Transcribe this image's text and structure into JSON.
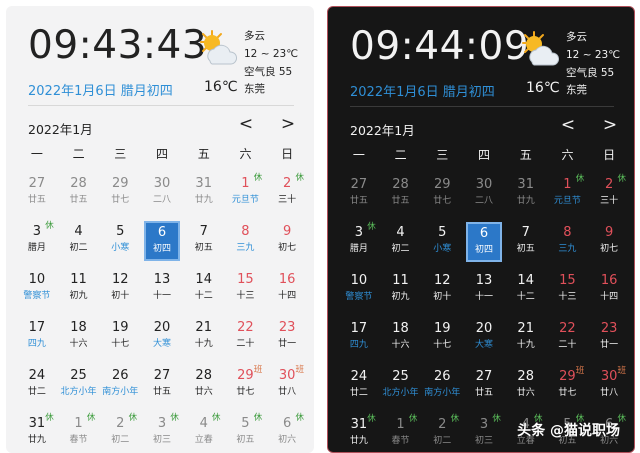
{
  "light": {
    "time": "09:43:43",
    "date": "2022年1月6日 腊月初四",
    "weather": {
      "condition": "多云",
      "range": "12 ~ 23℃",
      "air": "空气良 55",
      "temp": "16℃",
      "city": "东莞",
      "icon": "sun-cloud-icon"
    },
    "month": "2022年1月",
    "prev": "<",
    "next": ">"
  },
  "dark": {
    "time": "09:44:09",
    "date": "2022年1月6日 腊月初四",
    "weather": {
      "condition": "多云",
      "range": "12 ~ 23℃",
      "air": "空气良 55",
      "temp": "16℃",
      "city": "东莞",
      "icon": "sun-cloud-icon"
    },
    "month": "2022年1月",
    "prev": "<",
    "next": ">"
  },
  "weekdays": [
    "一",
    "二",
    "三",
    "四",
    "五",
    "六",
    "日"
  ],
  "days": [
    {
      "d": "27",
      "s": "廿五",
      "t": "other"
    },
    {
      "d": "28",
      "s": "廿五",
      "t": "other"
    },
    {
      "d": "29",
      "s": "廿七",
      "t": "other"
    },
    {
      "d": "30",
      "s": "二八",
      "t": "other"
    },
    {
      "d": "31",
      "s": "廿九",
      "t": "other"
    },
    {
      "d": "1",
      "s": "元旦节",
      "t": "weekend festival",
      "b": "休",
      "bt": "rest"
    },
    {
      "d": "2",
      "s": "三十",
      "t": "weekend",
      "b": "休",
      "bt": "rest"
    },
    {
      "d": "3",
      "s": "腊月",
      "t": "",
      "b": "休",
      "bt": "rest"
    },
    {
      "d": "4",
      "s": "初二",
      "t": ""
    },
    {
      "d": "5",
      "s": "小寒",
      "t": "festival"
    },
    {
      "d": "6",
      "s": "初四",
      "t": "today"
    },
    {
      "d": "7",
      "s": "初五",
      "t": ""
    },
    {
      "d": "8",
      "s": "三九",
      "t": "weekend festival"
    },
    {
      "d": "9",
      "s": "初七",
      "t": "weekend"
    },
    {
      "d": "10",
      "s": "警察节",
      "t": "festival"
    },
    {
      "d": "11",
      "s": "初九",
      "t": ""
    },
    {
      "d": "12",
      "s": "初十",
      "t": ""
    },
    {
      "d": "13",
      "s": "十一",
      "t": ""
    },
    {
      "d": "14",
      "s": "十二",
      "t": ""
    },
    {
      "d": "15",
      "s": "十三",
      "t": "weekend"
    },
    {
      "d": "16",
      "s": "十四",
      "t": "weekend"
    },
    {
      "d": "17",
      "s": "四九",
      "t": "festival"
    },
    {
      "d": "18",
      "s": "十六",
      "t": ""
    },
    {
      "d": "19",
      "s": "十七",
      "t": ""
    },
    {
      "d": "20",
      "s": "大寒",
      "t": "festival"
    },
    {
      "d": "21",
      "s": "十九",
      "t": ""
    },
    {
      "d": "22",
      "s": "二十",
      "t": "weekend"
    },
    {
      "d": "23",
      "s": "廿一",
      "t": "weekend"
    },
    {
      "d": "24",
      "s": "廿二",
      "t": ""
    },
    {
      "d": "25",
      "s": "北方小年",
      "t": "festival"
    },
    {
      "d": "26",
      "s": "南方小年",
      "t": "festival"
    },
    {
      "d": "27",
      "s": "廿五",
      "t": ""
    },
    {
      "d": "28",
      "s": "廿六",
      "t": ""
    },
    {
      "d": "29",
      "s": "廿七",
      "t": "weekend",
      "b": "班",
      "bt": "work"
    },
    {
      "d": "30",
      "s": "廿八",
      "t": "weekend",
      "b": "班",
      "bt": "work"
    },
    {
      "d": "31",
      "s": "廿九",
      "t": "",
      "b": "休",
      "bt": "rest"
    },
    {
      "d": "1",
      "s": "春节",
      "t": "other",
      "b": "休",
      "bt": "rest"
    },
    {
      "d": "2",
      "s": "初二",
      "t": "other",
      "b": "休",
      "bt": "rest"
    },
    {
      "d": "3",
      "s": "初三",
      "t": "other",
      "b": "休",
      "bt": "rest"
    },
    {
      "d": "4",
      "s": "立春",
      "t": "other",
      "b": "休",
      "bt": "rest"
    },
    {
      "d": "5",
      "s": "初五",
      "t": "other",
      "b": "休",
      "bt": "rest"
    },
    {
      "d": "6",
      "s": "初六",
      "t": "other",
      "b": "休",
      "bt": "rest"
    }
  ],
  "watermark": "头条 @猫说职场",
  "colors": {
    "accent": "#2f8fd6",
    "today": "#2c78c8",
    "weekend": "#e0505a",
    "rest": "#3a9a3a",
    "work": "#d9774b"
  }
}
